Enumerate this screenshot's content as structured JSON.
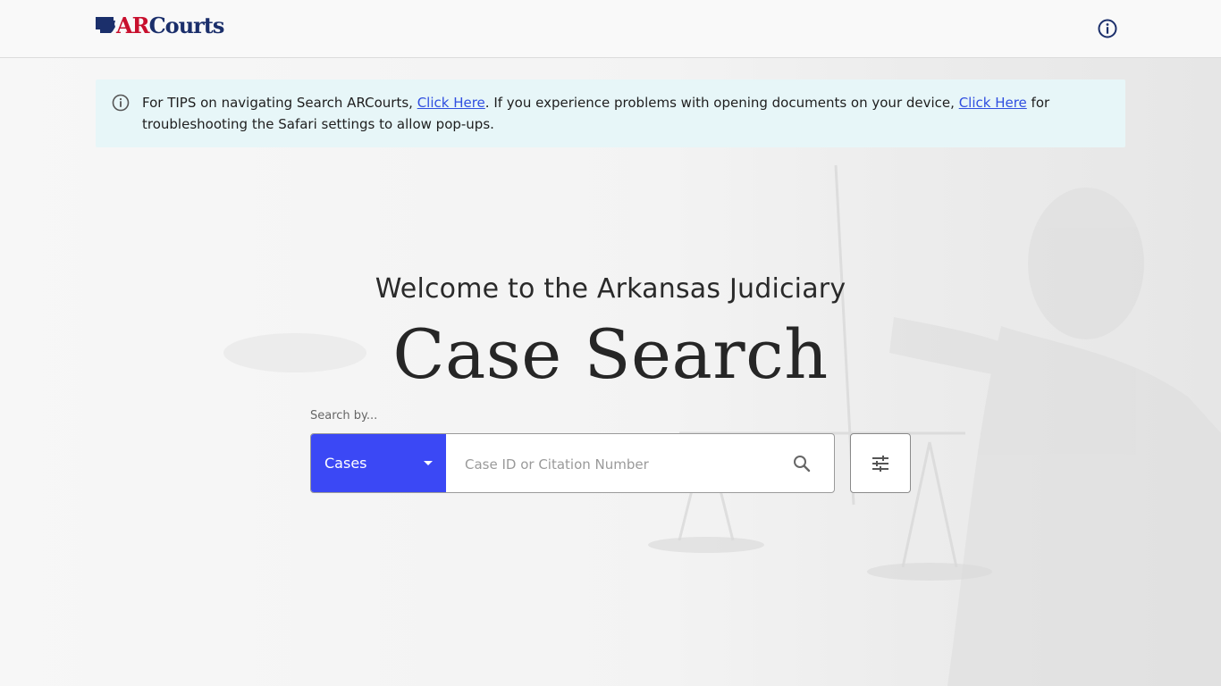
{
  "header": {
    "logo_ar": "AR",
    "logo_courts": "Courts",
    "info_icon": "info-circle-icon"
  },
  "banner": {
    "icon": "info-circle-icon",
    "text_1": "For TIPS on navigating Search ARCourts, ",
    "link_1": "Click Here",
    "text_2": ". If you experience problems with opening documents on your device, ",
    "link_2": "Click Here",
    "text_3": " for troubleshooting the Safari settings to allow pop-ups."
  },
  "hero": {
    "welcome": "Welcome to the Arkansas Judiciary",
    "title": "Case Search"
  },
  "search": {
    "label": "Search by...",
    "type_selected": "Cases",
    "placeholder": "Case ID or Citation Number",
    "value": "",
    "search_icon": "search-icon",
    "filter_icon": "tune-sliders-icon"
  },
  "colors": {
    "accent": "#3b48f5",
    "link": "#2f4ee0",
    "logo_red": "#c8102e",
    "logo_blue": "#1b2f6b",
    "banner_bg": "#e7f6f8"
  }
}
